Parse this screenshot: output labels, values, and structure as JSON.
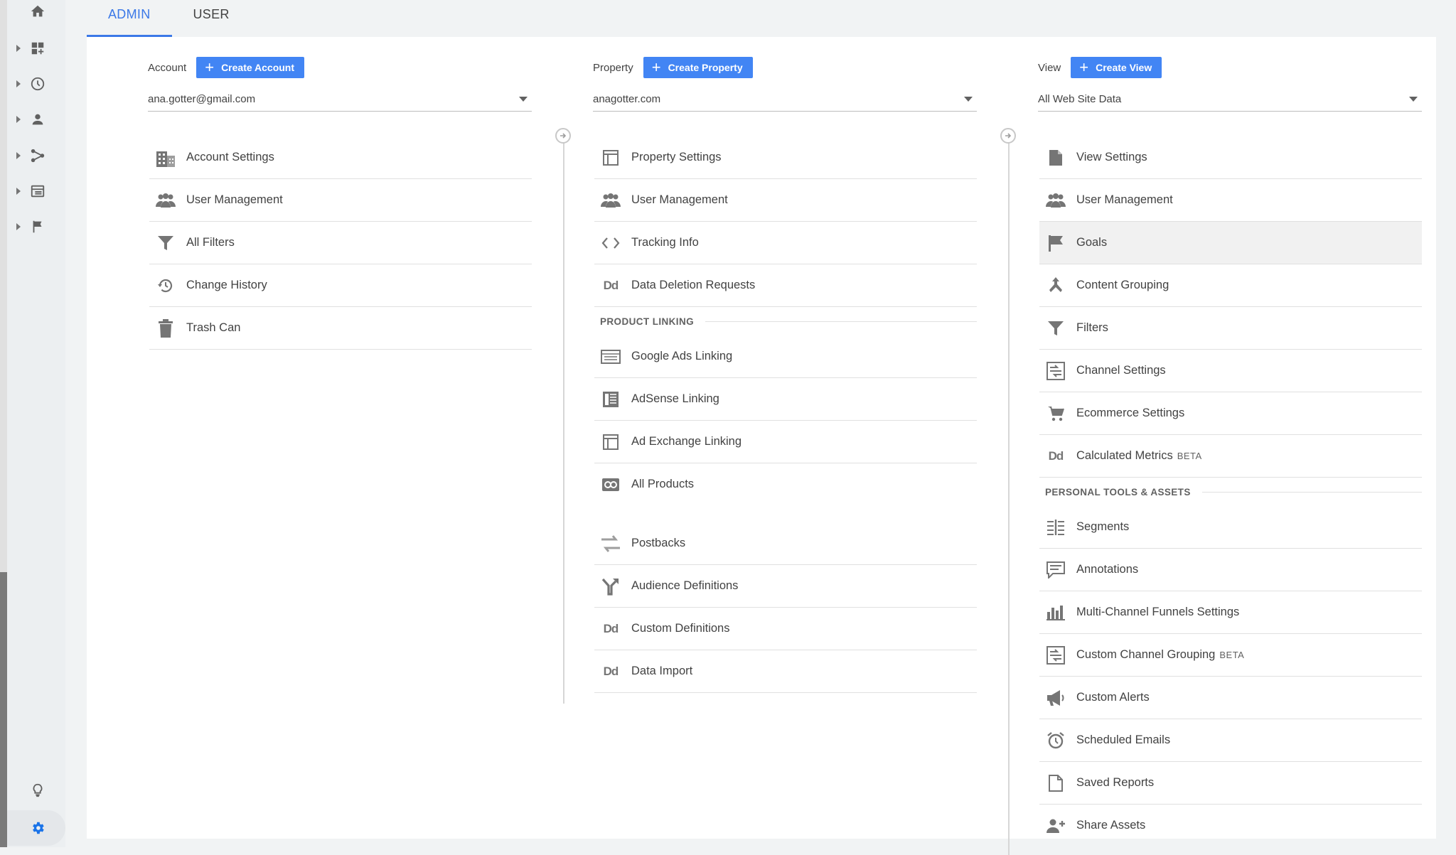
{
  "tabs": [
    {
      "label": "ADMIN",
      "active": true
    },
    {
      "label": "USER",
      "active": false
    }
  ],
  "sidenav": {
    "icons": [
      "home-icon",
      "dashboard-icon",
      "clock-icon",
      "person-icon",
      "acquisition-icon",
      "behavior-icon",
      "flag-icon",
      "lightbulb-icon",
      "gear-icon"
    ]
  },
  "account": {
    "label": "Account",
    "create_label": "Create Account",
    "selected": "ana.gotter@gmail.com",
    "items": [
      {
        "label": "Account Settings",
        "icon": "building-icon"
      },
      {
        "label": "User Management",
        "icon": "people-icon"
      },
      {
        "label": "All Filters",
        "icon": "funnel-icon"
      },
      {
        "label": "Change History",
        "icon": "history-icon"
      },
      {
        "label": "Trash Can",
        "icon": "trash-icon"
      }
    ]
  },
  "property": {
    "label": "Property",
    "create_label": "Create Property",
    "selected": "anagotter.com",
    "items": [
      {
        "label": "Property Settings",
        "icon": "window-icon"
      },
      {
        "label": "User Management",
        "icon": "people-icon"
      },
      {
        "label": "Tracking Info",
        "icon": "code-icon"
      },
      {
        "label": "Data Deletion Requests",
        "icon": "dd-icon"
      }
    ],
    "section_product_linking": "PRODUCT LINKING",
    "linking_items": [
      {
        "label": "Google Ads Linking",
        "icon": "ads-icon"
      },
      {
        "label": "AdSense Linking",
        "icon": "adsense-icon"
      },
      {
        "label": "Ad Exchange Linking",
        "icon": "window-icon"
      },
      {
        "label": "All Products",
        "icon": "link-icon"
      }
    ],
    "more_items": [
      {
        "label": "Postbacks",
        "icon": "swap-icon"
      },
      {
        "label": "Audience Definitions",
        "icon": "fork-icon"
      },
      {
        "label": "Custom Definitions",
        "icon": "dd-icon"
      },
      {
        "label": "Data Import",
        "icon": "dd-icon"
      }
    ]
  },
  "view": {
    "label": "View",
    "create_label": "Create View",
    "selected": "All Web Site Data",
    "items": [
      {
        "label": "View Settings",
        "icon": "document-icon"
      },
      {
        "label": "User Management",
        "icon": "people-icon"
      },
      {
        "label": "Goals",
        "icon": "flag-icon"
      },
      {
        "label": "Content Grouping",
        "icon": "grouping-icon"
      },
      {
        "label": "Filters",
        "icon": "funnel-icon"
      },
      {
        "label": "Channel Settings",
        "icon": "channel-icon"
      },
      {
        "label": "Ecommerce Settings",
        "icon": "cart-icon"
      },
      {
        "label": "Calculated Metrics",
        "beta": "BETA",
        "icon": "dd-icon"
      }
    ],
    "section_personal": "PERSONAL TOOLS & ASSETS",
    "personal_items": [
      {
        "label": "Segments",
        "icon": "segments-icon"
      },
      {
        "label": "Annotations",
        "icon": "comment-icon"
      },
      {
        "label": "Multi-Channel Funnels Settings",
        "icon": "barchart-icon"
      },
      {
        "label": "Custom Channel Grouping",
        "beta": "BETA",
        "icon": "channel-icon"
      },
      {
        "label": "Custom Alerts",
        "icon": "megaphone-icon"
      },
      {
        "label": "Scheduled Emails",
        "icon": "alarm-icon"
      },
      {
        "label": "Saved Reports",
        "icon": "page-icon"
      },
      {
        "label": "Share Assets",
        "icon": "add-person-icon"
      }
    ]
  },
  "colors": {
    "accent": "#4285f4",
    "tab_active": "#3b78e7",
    "icon": "#757575"
  }
}
